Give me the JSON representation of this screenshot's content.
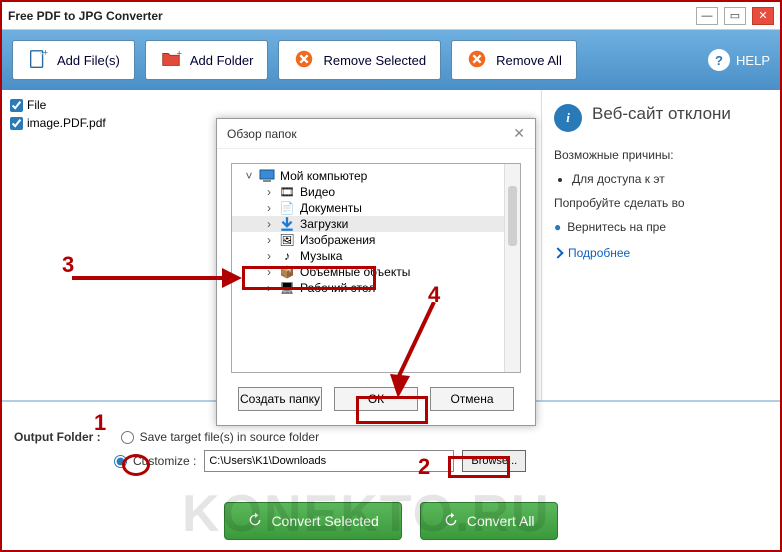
{
  "title": "Free PDF to JPG Converter",
  "toolbar": {
    "add_file": "Add File(s)",
    "add_folder": "Add Folder",
    "remove_selected": "Remove Selected",
    "remove_all": "Remove All",
    "help": "HELP"
  },
  "filelist": {
    "header": "File",
    "items": [
      "image.PDF.pdf"
    ]
  },
  "sidepanel": {
    "heading": "Веб-сайт отклони",
    "reasons_label": "Возможные причины:",
    "reasons": [
      "Для доступа к эт"
    ],
    "try_label": "Попробуйте сделать во",
    "try_items": [
      "Вернитесь на пре"
    ],
    "more": "Подробнее"
  },
  "dialog": {
    "title": "Обзор папок",
    "tree": {
      "root": "Мой компьютер",
      "children": [
        "Видео",
        "Документы",
        "Загрузки",
        "Изображения",
        "Музыка",
        "Объемные объекты",
        "Рабочий стол"
      ]
    },
    "create": "Создать папку",
    "ok": "ОК",
    "cancel": "Отмена"
  },
  "output": {
    "label": "Output Folder :",
    "opt_source": "Save target file(s) in source folder",
    "opt_custom": "Customize :",
    "path": "C:\\Users\\K1\\Downloads",
    "browse": "Browse..."
  },
  "convert": {
    "selected": "Convert Selected",
    "all": "Convert All"
  },
  "watermark": "KONEKTO.RU",
  "annotations": {
    "n1": "1",
    "n2": "2",
    "n3": "3",
    "n4": "4"
  }
}
